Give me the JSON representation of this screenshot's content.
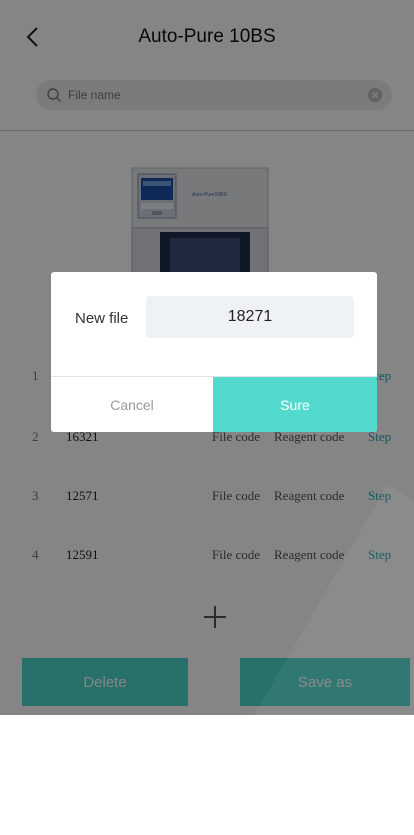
{
  "header": {
    "title": "Auto-Pure 10BS"
  },
  "search": {
    "placeholder": "File name"
  },
  "device": {
    "label": "Auto-Pure10BS"
  },
  "rows": [
    {
      "index": "1",
      "file": "",
      "file_code": "",
      "reagent_code": "",
      "step": "Step"
    },
    {
      "index": "2",
      "file": "16321",
      "file_code": "File code",
      "reagent_code": "Reagent code",
      "step": "Step"
    },
    {
      "index": "3",
      "file": "12571",
      "file_code": "File code",
      "reagent_code": "Reagent code",
      "step": "Step"
    },
    {
      "index": "4",
      "file": "12591",
      "file_code": "File code",
      "reagent_code": "Reagent code",
      "step": "Step"
    }
  ],
  "buttons": {
    "delete": "Delete",
    "save_as": "Save as"
  },
  "dialog": {
    "label": "New file",
    "value": "18271",
    "cancel": "Cancel",
    "sure": "Sure"
  },
  "colors": {
    "accent": "#4dd9ce",
    "step_link": "#1fa8b8"
  }
}
